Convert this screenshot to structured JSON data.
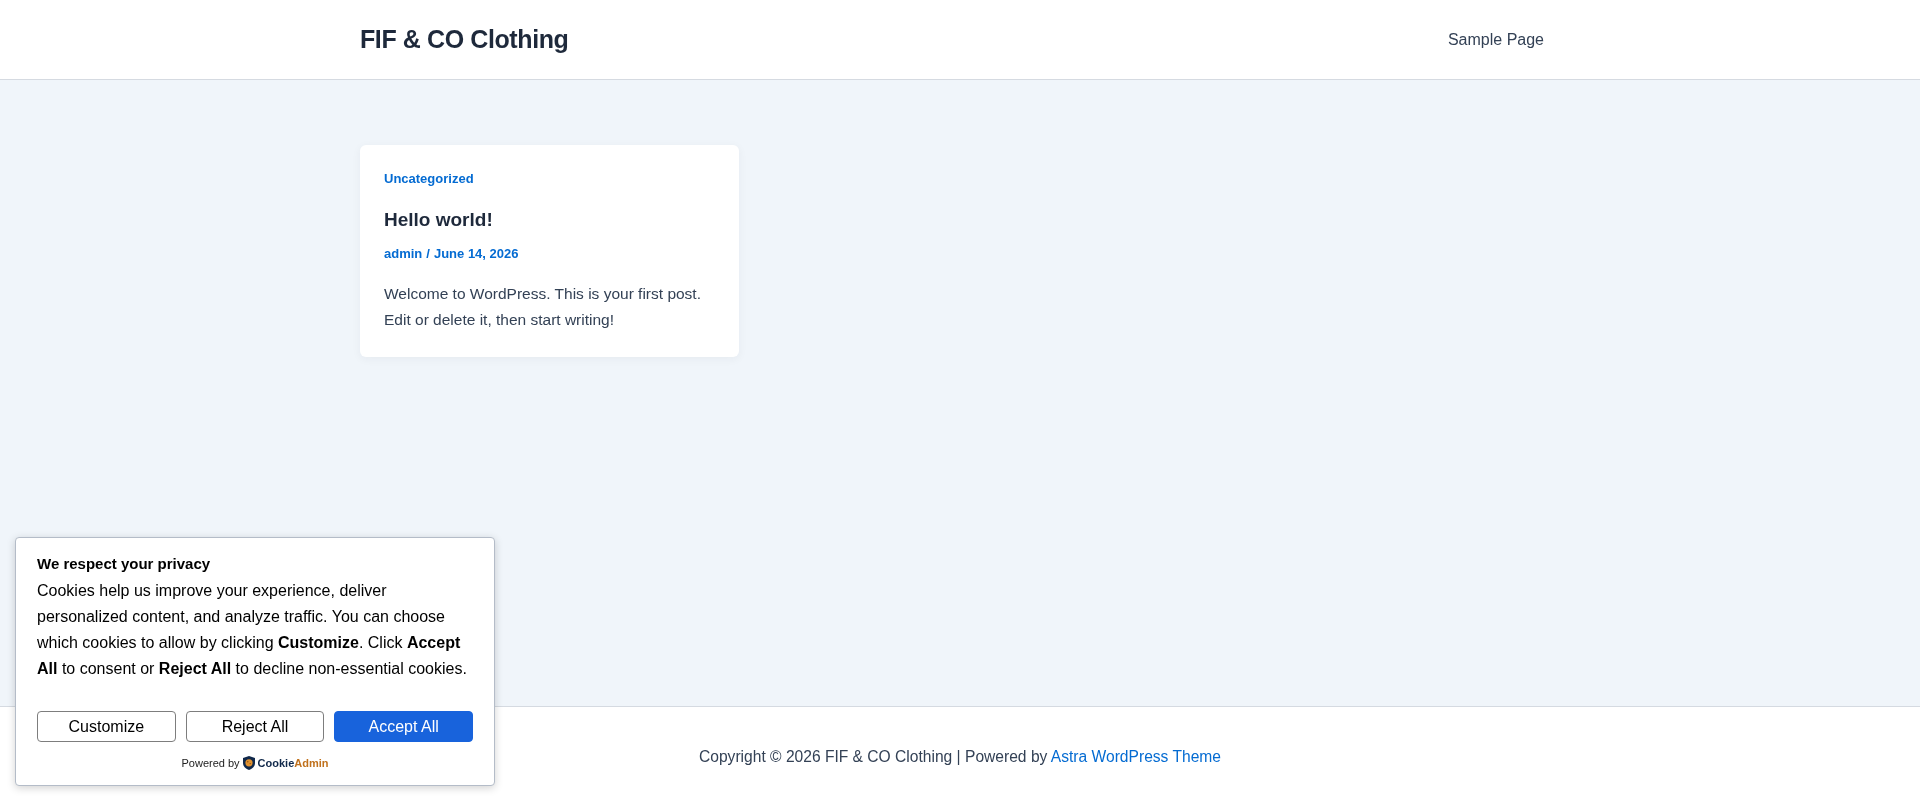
{
  "header": {
    "site_title": "FIF & CO Clothing",
    "nav": [
      {
        "label": "Sample Page"
      }
    ]
  },
  "posts": [
    {
      "category": "Uncategorized",
      "title": "Hello world!",
      "author": "admin",
      "separator": "/",
      "date": "June 14, 2026",
      "excerpt": "Welcome to WordPress. This is your first post. Edit or delete it, then start writing!"
    }
  ],
  "footer": {
    "text": "Copyright © 2026 FIF & CO Clothing | Powered by",
    "link": "Astra WordPress Theme"
  },
  "cookie_banner": {
    "title": "We respect your privacy",
    "message": "Cookies help us improve your experience, deliver personalized content, and analyze traffic. You can choose which cookies to allow by clicking **Customize**. Click **Accept All** to consent or **Reject All** to decline non-essential cookies.",
    "buttons": [
      {
        "label": "Customize",
        "kind": "secondary"
      },
      {
        "label": "Reject All",
        "kind": "secondary"
      },
      {
        "label": "Accept All",
        "kind": "primary"
      }
    ],
    "powered_by": "Powered by",
    "brand": [
      "Cookie",
      "Admin"
    ]
  }
}
